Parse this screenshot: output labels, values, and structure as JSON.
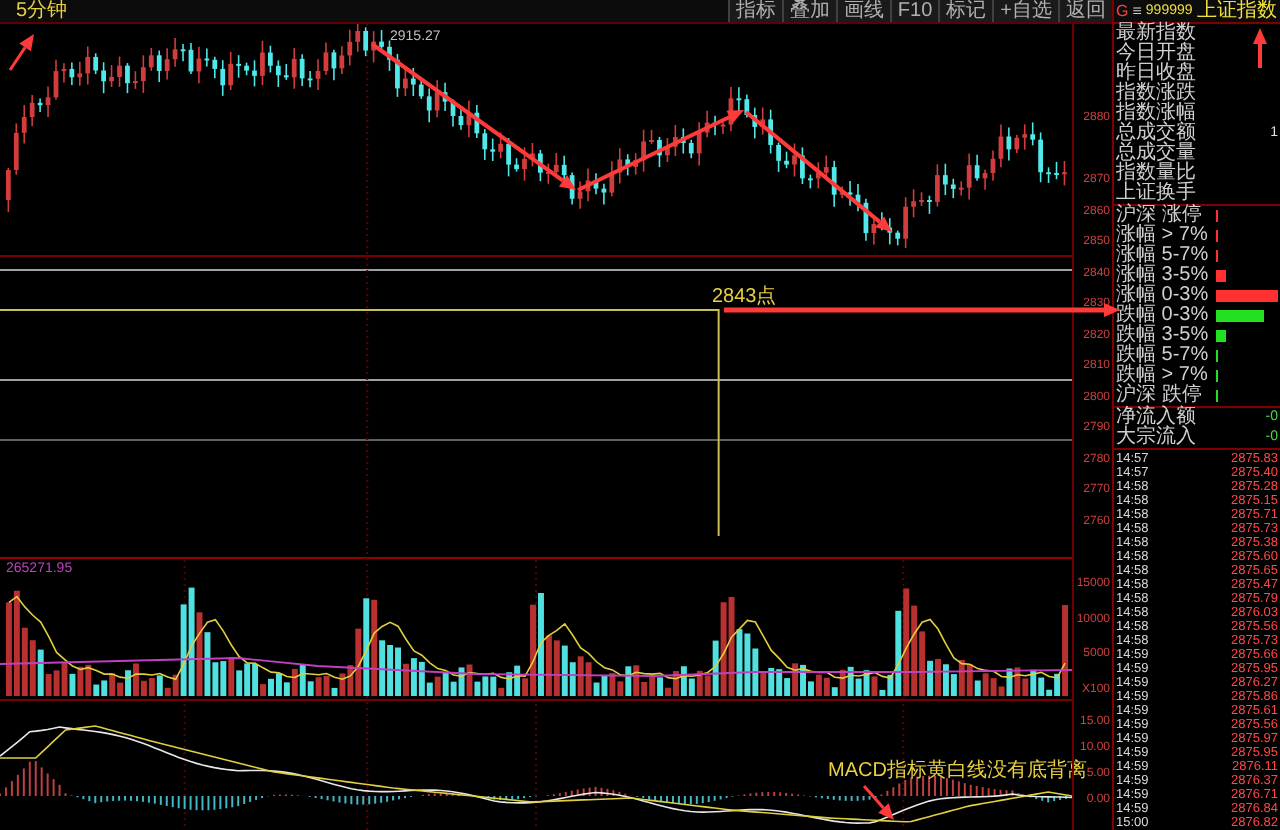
{
  "toolbar": {
    "buttons": [
      "指标",
      "叠加",
      "画线",
      "F10",
      "标记",
      "+自选",
      "返回"
    ]
  },
  "quote_header": {
    "market": "G",
    "menu_glyph": "≡",
    "code": "999999",
    "name": "上证指数"
  },
  "chart": {
    "period": "5分钟",
    "high_label": "2915.27",
    "level_label": "2843点",
    "price_ticks": [
      "2880",
      "2870",
      "2860",
      "2850",
      "2840",
      "2830",
      "2820",
      "2810",
      "2800",
      "2790",
      "2780",
      "2770",
      "2760"
    ],
    "volume_label": "265271.95",
    "volume_ticks": [
      "15000",
      "10000",
      "5000",
      "X100"
    ],
    "macd_ticks": [
      "15.00",
      "10.00",
      "5.00",
      "0.00"
    ],
    "macd_note": "MACD指标黄白线没有底背离"
  },
  "stats": [
    {
      "label": "最新指数"
    },
    {
      "label": "今日开盘"
    },
    {
      "label": "昨日收盘"
    },
    {
      "label": "指数涨跌"
    },
    {
      "label": "指数涨幅"
    },
    {
      "label": "总成交额",
      "value": "1"
    },
    {
      "label": "总成交量"
    },
    {
      "label": "指数量比"
    },
    {
      "label": "上证换手"
    }
  ],
  "breadth": [
    {
      "label": "沪深 涨停",
      "kind": "risetick"
    },
    {
      "label": "涨幅 > 7%",
      "kind": "risetick"
    },
    {
      "label": "涨幅 5-7%",
      "kind": "risetick"
    },
    {
      "label": "涨幅 3-5%",
      "kind": "risesmall"
    },
    {
      "label": "涨幅 0-3%",
      "kind": "risefull"
    },
    {
      "label": "跌幅 0-3%",
      "kind": "falllarge"
    },
    {
      "label": "跌幅 3-5%",
      "kind": "fallsmall"
    },
    {
      "label": "跌幅 5-7%",
      "kind": "falltick"
    },
    {
      "label": "跌幅 > 7%",
      "kind": "falltick"
    },
    {
      "label": "沪深 跌停",
      "kind": "falltick"
    }
  ],
  "flows": [
    {
      "label": "净流入额",
      "value": "-0"
    },
    {
      "label": "大宗流入",
      "value": "-0"
    }
  ],
  "ticks": [
    {
      "time": "14:57",
      "price": "2875.83"
    },
    {
      "time": "14:57",
      "price": "2875.40"
    },
    {
      "time": "14:58",
      "price": "2875.28"
    },
    {
      "time": "14:58",
      "price": "2875.15"
    },
    {
      "time": "14:58",
      "price": "2875.71"
    },
    {
      "time": "14:58",
      "price": "2875.73"
    },
    {
      "time": "14:58",
      "price": "2875.38"
    },
    {
      "time": "14:58",
      "price": "2875.60"
    },
    {
      "time": "14:58",
      "price": "2875.65"
    },
    {
      "time": "14:58",
      "price": "2875.47"
    },
    {
      "time": "14:58",
      "price": "2875.79"
    },
    {
      "time": "14:58",
      "price": "2876.03"
    },
    {
      "time": "14:58",
      "price": "2875.56"
    },
    {
      "time": "14:58",
      "price": "2875.73"
    },
    {
      "time": "14:59",
      "price": "2875.66"
    },
    {
      "time": "14:59",
      "price": "2875.95"
    },
    {
      "time": "14:59",
      "price": "2876.27"
    },
    {
      "time": "14:59",
      "price": "2875.86"
    },
    {
      "time": "14:59",
      "price": "2875.61"
    },
    {
      "time": "14:59",
      "price": "2875.56"
    },
    {
      "time": "14:59",
      "price": "2875.97"
    },
    {
      "time": "14:59",
      "price": "2875.95"
    },
    {
      "time": "14:59",
      "price": "2876.11"
    },
    {
      "time": "14:59",
      "price": "2876.37"
    },
    {
      "time": "14:59",
      "price": "2876.71"
    },
    {
      "time": "14:59",
      "price": "2876.84"
    },
    {
      "time": "15:00",
      "price": "2876.82"
    }
  ]
}
